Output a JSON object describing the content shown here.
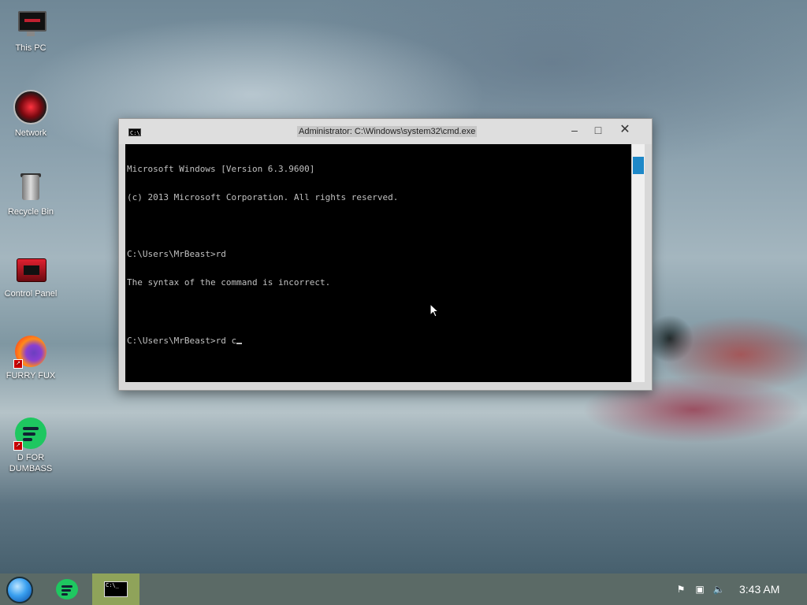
{
  "desktop": {
    "icons": [
      {
        "label": "This PC"
      },
      {
        "label": "Network"
      },
      {
        "label": "Recycle Bin"
      },
      {
        "label": "Control Panel"
      },
      {
        "label": "FURRY FUX"
      },
      {
        "label": "D FOR\nDUMBASS"
      }
    ]
  },
  "cmd_window": {
    "title": "Administrator: C:\\Windows\\system32\\cmd.exe",
    "icon_text": "C:\\.",
    "lines": [
      "Microsoft Windows [Version 6.3.9600]",
      "(c) 2013 Microsoft Corporation. All rights reserved.",
      "",
      "C:\\Users\\MrBeast>rd",
      "The syntax of the command is incorrect.",
      "",
      "C:\\Users\\MrBeast>rd c"
    ],
    "buttons": {
      "minimize": "–",
      "maximize": "□",
      "close": "✕"
    }
  },
  "taskbar": {
    "cmd_icon_text": "C:\\_",
    "tray": {
      "flag": "⚑",
      "network": "▣",
      "volume": "🔈"
    },
    "clock": "3:43 AM"
  }
}
